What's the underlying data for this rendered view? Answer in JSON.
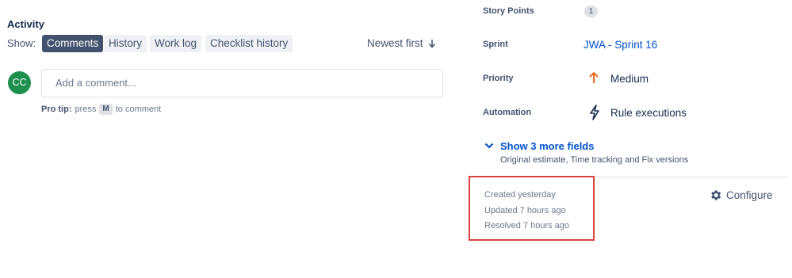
{
  "activity": {
    "title": "Activity",
    "show_label": "Show:",
    "tabs": [
      {
        "label": "Comments",
        "active": true
      },
      {
        "label": "History",
        "active": false
      },
      {
        "label": "Work log",
        "active": false
      },
      {
        "label": "Checklist history",
        "active": false
      }
    ],
    "sort_label": "Newest first"
  },
  "comment": {
    "avatar_initials": "CC",
    "placeholder": "Add a comment...",
    "protip_bold": "Pro tip:",
    "protip_pre": "press",
    "protip_key": "M",
    "protip_post": "to comment"
  },
  "fields": {
    "story_points": {
      "label": "Story Points",
      "value": "1"
    },
    "sprint": {
      "label": "Sprint",
      "value": "JWA - Sprint 16"
    },
    "priority": {
      "label": "Priority",
      "value": "Medium",
      "icon": "arrow-up-icon",
      "color": "#e86b25"
    },
    "automation": {
      "label": "Automation",
      "value": "Rule executions",
      "icon": "lightning-bolt-icon"
    }
  },
  "more_fields": {
    "label": "Show 3 more fields",
    "sub": "Original estimate, Time tracking and Fix versions"
  },
  "meta": {
    "created": "Created yesterday",
    "updated": "Updated 7 hours ago",
    "resolved": "Resolved 7 hours ago"
  },
  "configure_label": "Configure",
  "colors": {
    "link": "#0052cc",
    "active_tab": "#42526e",
    "avatar": "#1f8f4f",
    "highlight": "#d9413e"
  }
}
